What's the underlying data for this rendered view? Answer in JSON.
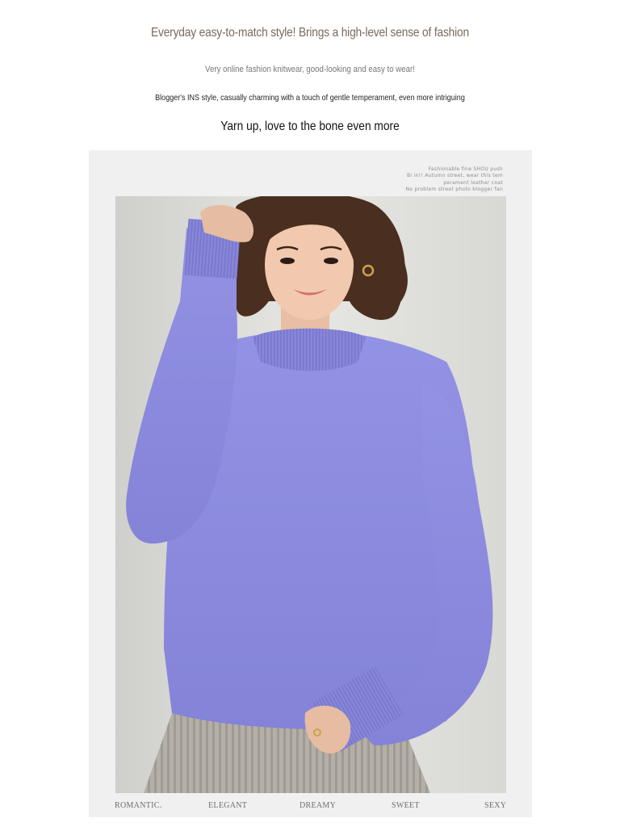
{
  "header": {
    "headline": "Everyday easy-to-match style! Brings a high-level sense of fashion",
    "line1": "Very online fashion knitwear, good-looking and easy to wear!",
    "line2": "Blogger's INS style, casually charming with a touch of gentle temperament, even more intriguing",
    "line3": "Yarn up, love to the bone even more"
  },
  "panel": {
    "caption_lines": [
      "Fashionable fine SHOU push",
      "Bi in!! Autumn street, wear this tem",
      "perament leather coat",
      "No problem street photo blogger fan"
    ],
    "tags": [
      "ROMANTIC.",
      "ELEGANT",
      "DREAMY",
      "SWEET",
      "SEXY"
    ]
  },
  "colors": {
    "headline": "#7a6a5a",
    "sweater": "#8f8ee0",
    "panel_bg": "#f0f0f0",
    "skirt": "#b3aea6"
  }
}
